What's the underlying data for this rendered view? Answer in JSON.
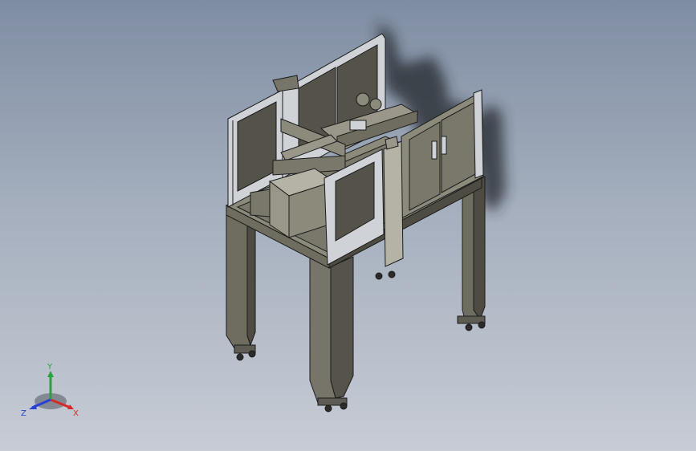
{
  "scene": {
    "colors": {
      "bg_top": "#7f8da3",
      "bg_bottom": "#c7ccd5",
      "body": "#6f6d5f",
      "body_light": "#8c8a7b",
      "body_dark": "#4e4c42",
      "frame": "#cfd2d6",
      "panel": "#55524a",
      "outline": "#1b1b1b"
    }
  },
  "triad": {
    "x_label": "X",
    "y_label": "Y",
    "z_label": "Z",
    "x_color": "#d42a2a",
    "y_color": "#27a33a",
    "z_color": "#2a3fd4"
  }
}
